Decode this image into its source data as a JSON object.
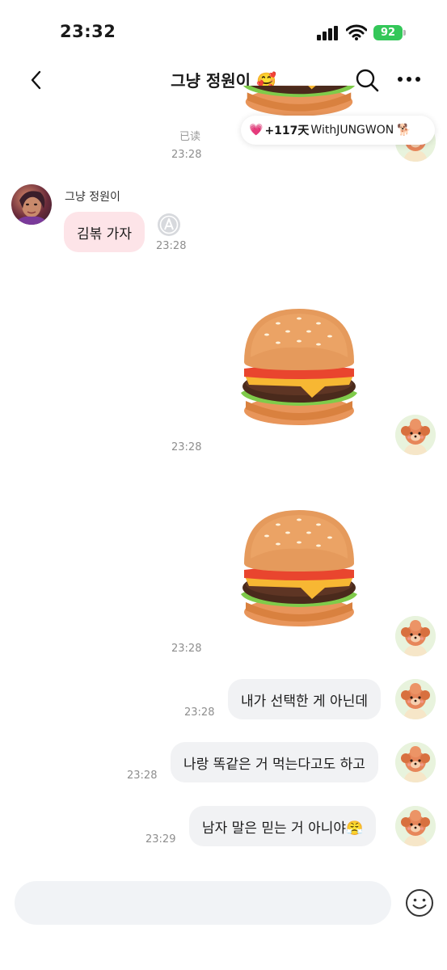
{
  "status_bar": {
    "time": "23:32",
    "battery": "92"
  },
  "header": {
    "title": "그냥 정원이 🥰"
  },
  "banner": {
    "heart": "💗",
    "days": "+117天",
    "label": "WithJUNGWON",
    "pet": "🐕"
  },
  "partner": {
    "name": "그냥 정원이"
  },
  "messages": [
    {
      "id": "m0",
      "direction": "out",
      "type": "sticker",
      "read": "已读",
      "time": "23:28"
    },
    {
      "id": "m1",
      "direction": "in",
      "type": "text",
      "text": "김볶 가자",
      "time": "23:28"
    },
    {
      "id": "m2",
      "direction": "out",
      "type": "sticker",
      "sticker": "burger",
      "time": "23:28"
    },
    {
      "id": "m3",
      "direction": "out",
      "type": "sticker",
      "sticker": "burger",
      "time": "23:28"
    },
    {
      "id": "m4",
      "direction": "out",
      "type": "text",
      "text": "내가 선택한 게 아닌데",
      "time": "23:28"
    },
    {
      "id": "m5",
      "direction": "out",
      "type": "text",
      "text": "나랑 똑같은 거 먹는다고도 하고",
      "time": "23:28"
    },
    {
      "id": "m6",
      "direction": "out",
      "type": "text",
      "text": "남자 말은 믿는 거 아니야😤",
      "time": "23:29"
    }
  ],
  "input": {
    "placeholder": ""
  }
}
